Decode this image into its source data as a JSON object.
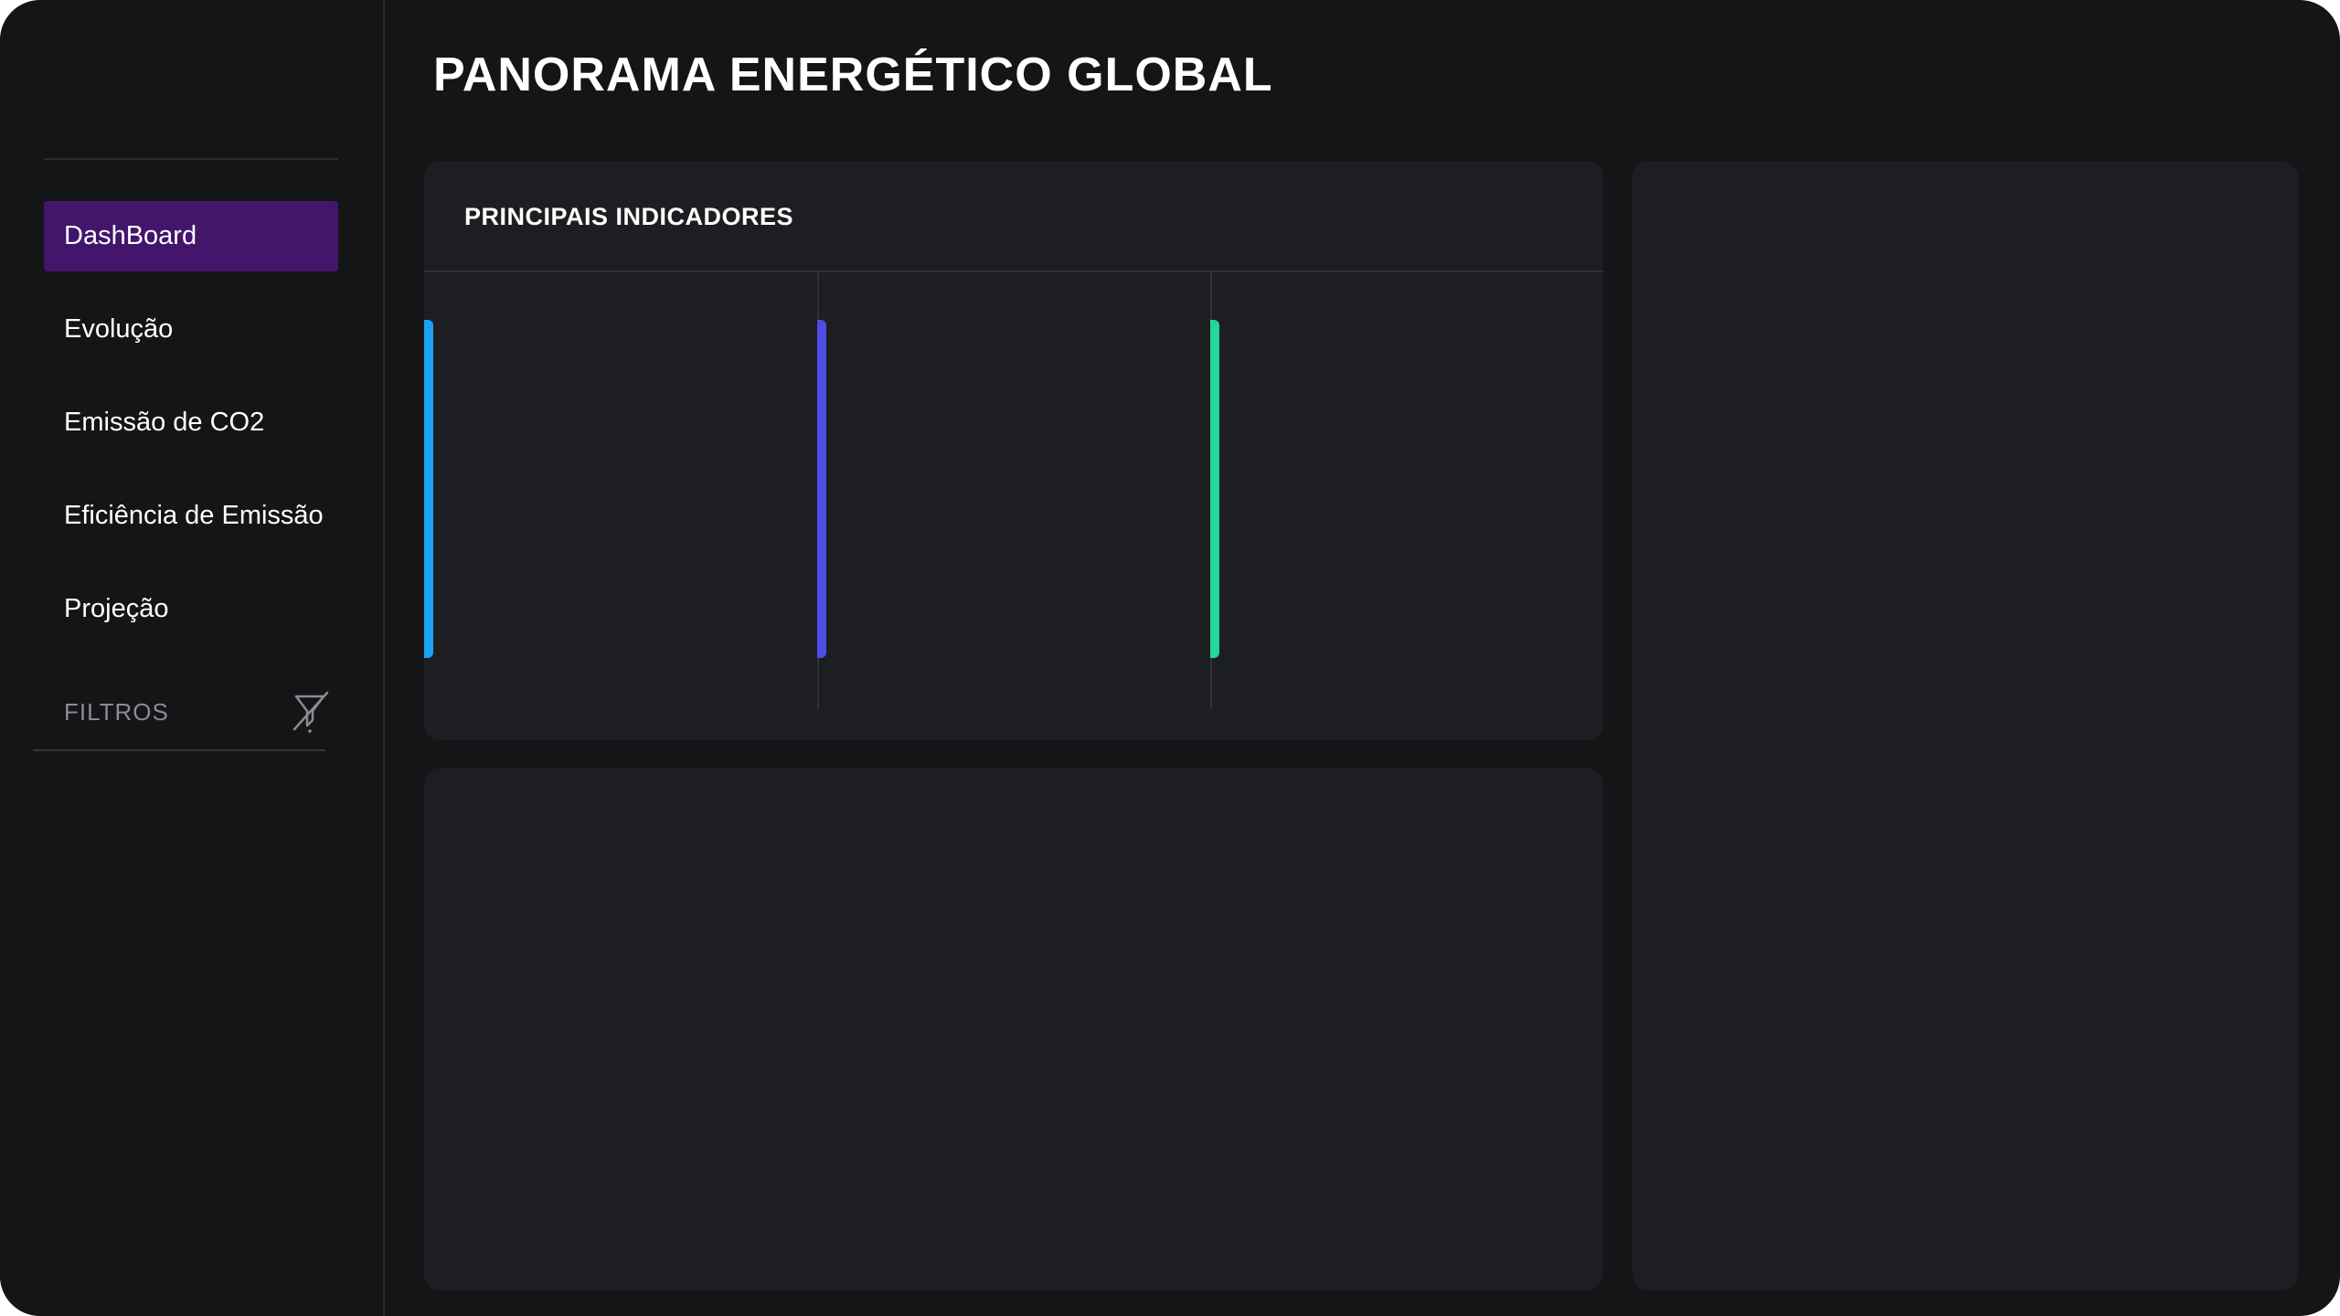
{
  "header": {
    "title": "PANORAMA ENERGÉTICO GLOBAL"
  },
  "sidebar": {
    "items": [
      {
        "label": "DashBoard",
        "active": true
      },
      {
        "label": "Evolução",
        "active": false
      },
      {
        "label": "Emissão de CO2",
        "active": false
      },
      {
        "label": "Eficiência de Emissão",
        "active": false
      },
      {
        "label": "Projeção",
        "active": false
      }
    ],
    "filters": {
      "label": "FILTROS",
      "icon": "filter-off-icon"
    }
  },
  "indicators": {
    "title": "PRINCIPAIS INDICADORES",
    "cards": [
      {
        "accent_color": "#1aa3f5"
      },
      {
        "accent_color": "#4f4be6"
      },
      {
        "accent_color": "#27d49a"
      }
    ]
  },
  "colors": {
    "background": "#141517",
    "panel": "#1c1e22",
    "active_nav": "#43156b",
    "muted_text": "#8a8c91"
  }
}
